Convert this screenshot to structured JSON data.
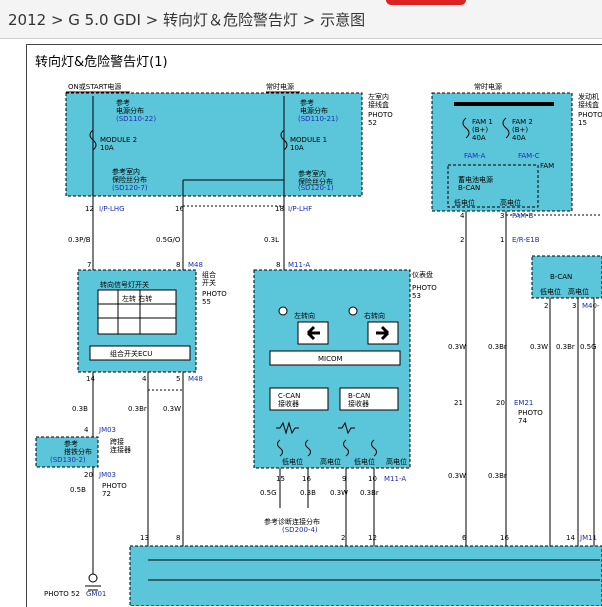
{
  "breadcrumb": "2012 > G 5.0 GDI > 转向灯＆危险警告灯 > 示意图",
  "panel_title": "转向灯&危险警告灯(1)",
  "colors": {
    "box": "#5bc6da",
    "wire": "#000000",
    "link": "#1a2fb0",
    "brand": "#d22222"
  },
  "top_labels": {
    "on_start": "ON或START电源",
    "always1": "常时电源",
    "always2": "常时电源",
    "inroom_jb": "左室内\n接线盒",
    "photo52a": "PHOTO\n52",
    "engine_room": "发动机\n接线盒",
    "photo15": "PHOTO\n15"
  },
  "jb1": {
    "ref1": "参考\n电源分布",
    "ref1_code": "(SD110-22)",
    "mod2": "MODULE 2\n10A",
    "ref2": "参考室内\n保险丝分布",
    "ref2_code": "(SD120-7)"
  },
  "jb2": {
    "ref1": "参考\n电源分布",
    "ref1_code": "(SD110-21)",
    "mod1": "MODULE 1\n10A",
    "ref2": "参考室内\n保险丝分布",
    "ref2_code": "(SD120-1)"
  },
  "ejb": {
    "fam1": "FAM 1\n(B+)\n40A",
    "fam2": "FAM 2\n(B+)\n40A",
    "fama": "FAM-A",
    "famc": "FAM-C",
    "fam": "FAM",
    "sub": "蓄电池电源\nB-CAN",
    "lo": "低电位",
    "hi": "高电位",
    "famb": "FAM-B",
    "er": "E/R-E1B"
  },
  "pins": {
    "p12": "12",
    "p16": "16",
    "p18": "18",
    "p4": "4",
    "p3": "3",
    "p7": "7",
    "p8a": "8",
    "p8b": "8",
    "p14": "14",
    "p4b": "4",
    "p5": "5",
    "p15": "15",
    "p16b": "16",
    "p9": "9",
    "p10": "10",
    "p2": "2",
    "p1": "1",
    "p2b": "2",
    "p3b": "3",
    "p21": "21",
    "p20": "20",
    "p13": "13",
    "p8c": "8",
    "p2c": "2",
    "p12b": "12",
    "p6": "6",
    "p16c": "16",
    "p4c": "4",
    "p14b": "14",
    "p20b": "20"
  },
  "connectors": {
    "ip_lhg": "I/P-LHG",
    "ip_lhf": "I/P-LHF",
    "m48a": "M48",
    "m48b": "M48",
    "m11a": "M11-A",
    "m11a2": "M11-A",
    "jm03": "JM03",
    "jm03b": "JM03",
    "em21": "EM21",
    "m40": "M40-",
    "jm11": "JM11",
    "gm01": "GM01"
  },
  "wires": {
    "w1": "0.3P/B",
    "w2": "0.5G/O",
    "w3": "0.3L",
    "w4": "0.3B",
    "w5": "0.3Br",
    "w6": "0.3W",
    "w7": "0.5G",
    "w8": "0.3W",
    "w9": "0.3Br",
    "w10": "0.3W",
    "w11": "0.3Br",
    "w12": "0.3W",
    "w13": "0.3Br",
    "w14": "0.3W",
    "w15": "0.3Br",
    "w16": "0.3B",
    "w17": "0.5B",
    "w18": "0.5G"
  },
  "combo": {
    "label": "组合\n开关",
    "photo": "PHOTO\n55",
    "switch_title": "转向信号灯开关",
    "cols": "左转 右转",
    "ecu": "组合开关ECU",
    "rows": [
      "L",
      "N",
      "R"
    ]
  },
  "cluster": {
    "label": "仪表盘",
    "photo": "PHOTO\n53",
    "left": "左转向",
    "right": "右转向",
    "micom": "MICOM",
    "ccan": "C-CAN\n接收器",
    "bcan": "B-CAN\n接收器",
    "lo1": "低电位",
    "hi1": "高电位",
    "lo2": "低电位",
    "hi2": "高电位",
    "diag": "参考诊断连接分布",
    "diag_code": "(SD200-4)"
  },
  "jc": {
    "ref": "参考\n搭铁分布",
    "ref_code": "(SD130-2)",
    "name": "跨接\n连接器",
    "photo72": "PHOTO\n72"
  },
  "bcan_box": {
    "title": "B-CAN",
    "lo": "低电位",
    "hi": "高电位"
  },
  "photo74": "PHOTO\n74",
  "photo52b": "PHOTO 52"
}
